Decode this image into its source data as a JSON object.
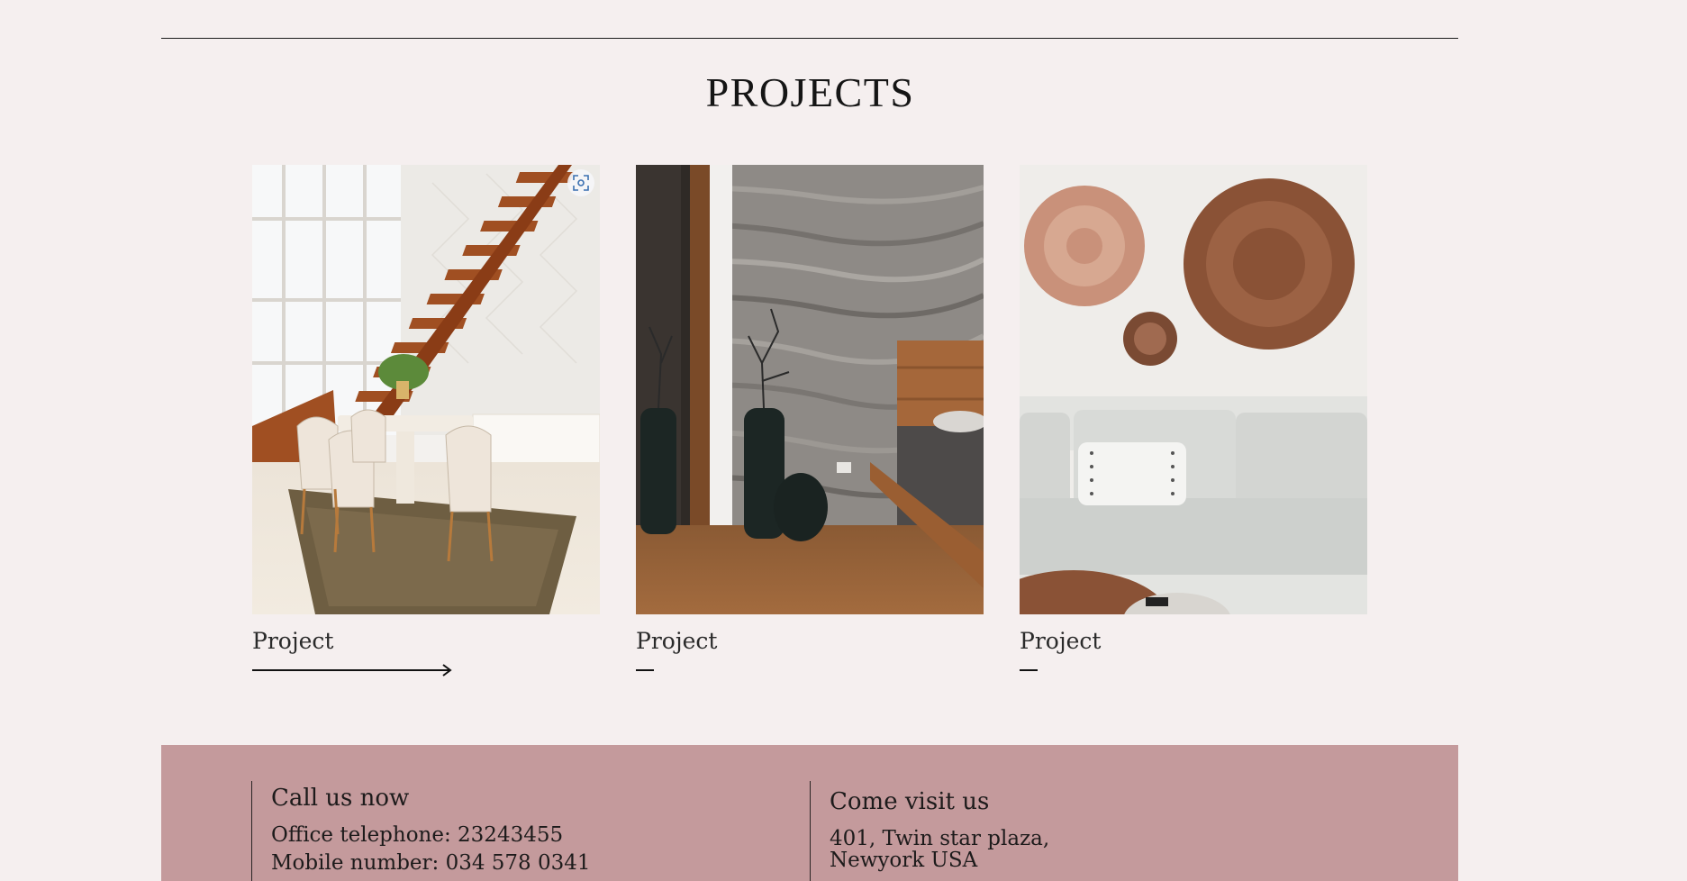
{
  "section": {
    "title": "PROJECTS"
  },
  "projects": [
    {
      "label": "Project",
      "image": "staircase-dining-room-photo",
      "arrow": "long-right-arrow"
    },
    {
      "label": "Project",
      "image": "marble-bedroom-vases-photo",
      "arrow": "short-dash"
    },
    {
      "label": "Project",
      "image": "wall-baskets-sofa-photo",
      "arrow": "short-dash"
    }
  ],
  "zoom_button": {
    "icon": "zoom-scan-icon"
  },
  "footer": {
    "background": "#c49a9c",
    "call": {
      "heading": "Call us now",
      "office": "Office telephone: 23243455",
      "mobile": "Mobile number: 034 578 0341"
    },
    "visit": {
      "heading": "Come visit us",
      "address_line1": "401, Twin star plaza,",
      "address_line2": "Newyork USA"
    }
  },
  "colors": {
    "page_background": "#f5efef",
    "text": "#1b1b1b"
  }
}
